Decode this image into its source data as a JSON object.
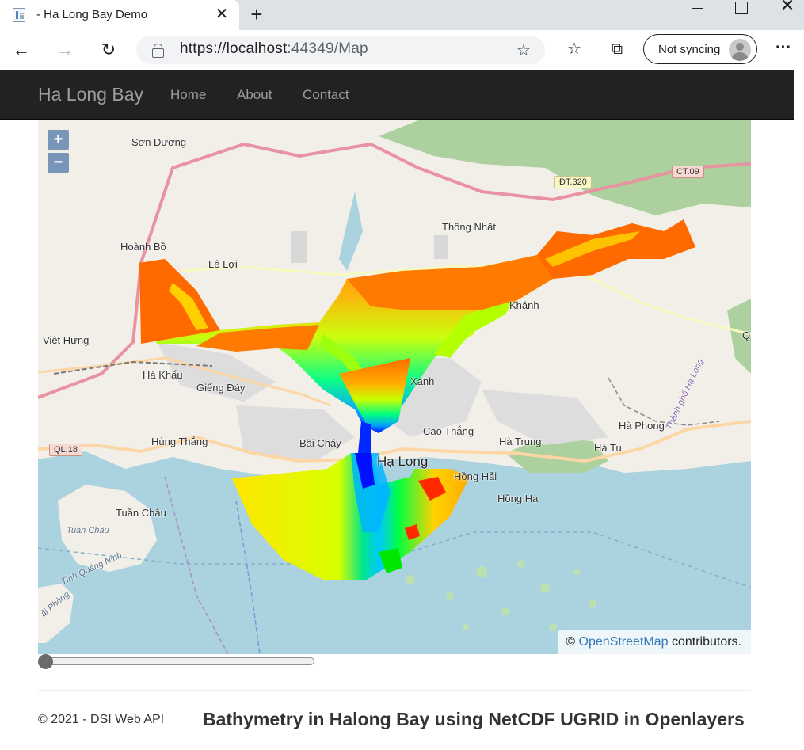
{
  "browser": {
    "tab_title": "- Ha Long Bay Demo",
    "url_host": "https://localhost",
    "url_rest": ":44349/Map",
    "sync_label": "Not syncing"
  },
  "navbar": {
    "brand": "Ha Long Bay",
    "links": [
      "Home",
      "About",
      "Contact"
    ]
  },
  "map": {
    "zoom_in": "+",
    "zoom_out": "−",
    "attribution_prefix": "©",
    "attribution_link": "OpenStreetMap",
    "attribution_suffix": "contributors.",
    "place_labels": [
      "Sơn Dương",
      "Hoành Bồ",
      "Lê Lợi",
      "Việt Hưng",
      "Thống Nhất",
      "Khánh",
      "Hà Khẩu",
      "Giếng Đáy",
      "Xanh",
      "Cao Thắng",
      "Hùng Thắng",
      "Bãi Cháy",
      "Hạ Long",
      "Hà Trung",
      "Hà Phong",
      "Hà Tu",
      "Hồng Hải",
      "Hồng Hà",
      "Tuần Châu",
      "Tuần Châu",
      "Tỉnh Quảng Ninh",
      "ải Phòng",
      "Thành phố Hạ Long",
      "Q"
    ],
    "road_labels": [
      "ĐT.320",
      "CT.09",
      "QL.18"
    ]
  },
  "time_slider": {
    "value": 0
  },
  "footer": {
    "copyright": "© 2021 - DSI Web API",
    "title": "Bathymetry in Halong Bay using NetCDF UGRID in Openlayers"
  }
}
